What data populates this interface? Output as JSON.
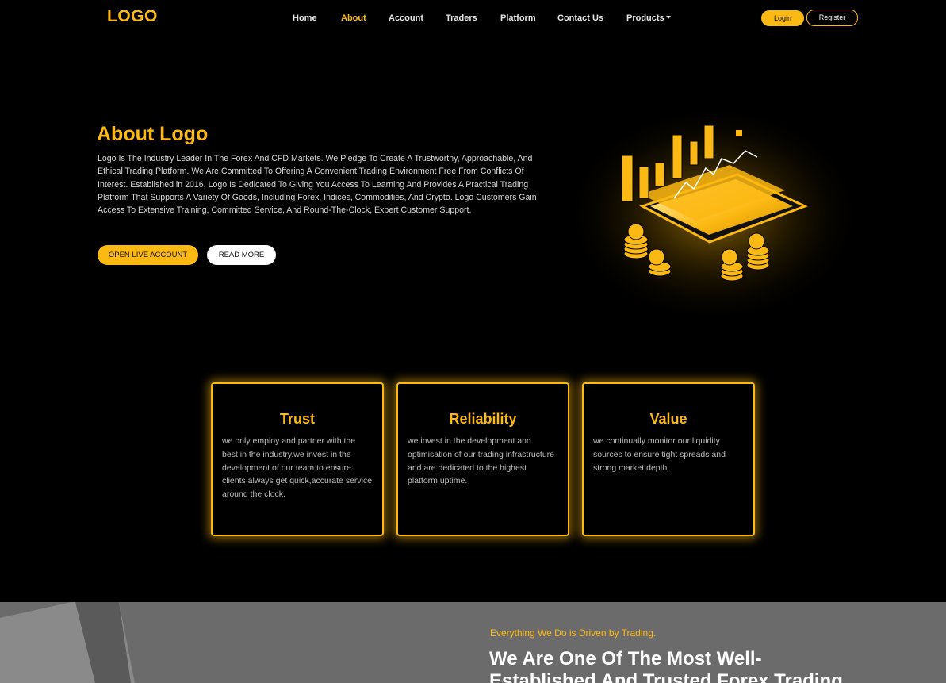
{
  "nav": {
    "logo": "LOGO",
    "items": [
      {
        "label": "Home"
      },
      {
        "label": "About"
      },
      {
        "label": "Account"
      },
      {
        "label": "Traders"
      },
      {
        "label": "Platform"
      },
      {
        "label": "Contact Us"
      },
      {
        "label": "Products"
      }
    ],
    "active": "About",
    "login_label": "Login",
    "register_label": "Register"
  },
  "hero": {
    "title": "About Logo",
    "text": "Logo Is The Industry Leader In The Forex And CFD Markets. We Pledge To Create A Trustworthy, Approachable, And Ethical Trading Platform. We Are Committed To Offering A Convenient Trading Environment Free From Conflicts Of Interest. Established in 2016, Logo Is Dedicated To Giving You Access To Learning And Provides A Practical Trading Platform That Supports A Variety Of Goods, Including Forex, Indices, Commodities, And Crypto. Logo Customers Gain Access To Extensive Training, Committed Service, And Round-The-Clock, Expert Customer Support.",
    "open_account_label": "OPEN LIVE ACCOUNT",
    "read_more_label": "READ MORE"
  },
  "cards": [
    {
      "title": "Trust",
      "text": "we only employ and partner with the best in the industry.we invest in the development of our team to ensure clients always get quick,accurate service around the clock."
    },
    {
      "title": "Reliability",
      "text": "we invest in the development and optimisation of our trading infrastructure and are dedicated to the highest platform uptime."
    },
    {
      "title": "Value",
      "text": "we continually monitor our liquidity sources to ensure tight spreads and strong market depth."
    }
  ],
  "bottom": {
    "tagline": "Everything We Do is Driven by Trading.",
    "heading": "We Are One Of The Most Well-Established And Trusted Forex Trading"
  },
  "colors": {
    "accent": "#fdb913",
    "background": "#000000",
    "bottom_bg": "#6b6b6b"
  }
}
